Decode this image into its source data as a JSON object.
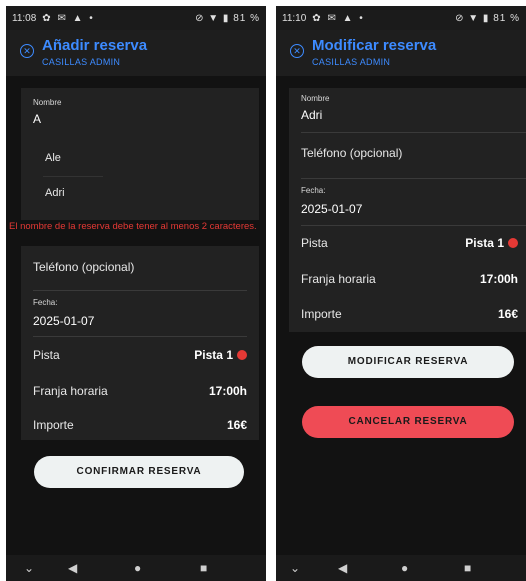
{
  "left": {
    "status": {
      "time": "11:08",
      "icons": "✿ ✉ ▲ •",
      "right": "⊘ ▼ ▮ 81 %"
    },
    "appbar": {
      "title": "Añadir reserva",
      "subtitle": "CASILLAS ADMIN",
      "close_icon": "ⓧ"
    },
    "form": {
      "name_label": "Nombre",
      "name_value": "A",
      "suggestions": [
        "Ale",
        "Adri"
      ],
      "error": "El nombre de la reserva debe tener al menos 2 caracteres.",
      "phone_placeholder": "Teléfono (opcional)",
      "date_label": "Fecha:",
      "date_value": "2025-01-07",
      "court_label": "Pista",
      "court_value": "Pista 1",
      "slot_label": "Franja horaria",
      "slot_value": "17:00h",
      "amount_label": "Importe",
      "amount_value": "16€"
    },
    "confirm_button": "CONFIRMAR RESERVA",
    "nav": {
      "down": "⌄",
      "back": "◀",
      "home": "●",
      "recents": "■"
    }
  },
  "right": {
    "status": {
      "time": "11:10",
      "icons": "✿ ✉ ▲ •",
      "right": "⊘ ▼ ▮ 81 %"
    },
    "appbar": {
      "title": "Modificar reserva",
      "subtitle": "CASILLAS ADMIN",
      "close_icon": "ⓧ"
    },
    "form": {
      "name_label": "Nombre",
      "name_value": "Adri",
      "phone_placeholder": "Teléfono (opcional)",
      "date_label": "Fecha:",
      "date_value": "2025-01-07",
      "court_label": "Pista",
      "court_value": "Pista 1",
      "slot_label": "Franja horaria",
      "slot_value": "17:00h",
      "amount_label": "Importe",
      "amount_value": "16€"
    },
    "modify_button": "MODIFICAR RESERVA",
    "cancel_button": "CANCELAR RESERVA",
    "nav": {
      "down": "⌄",
      "back": "◀",
      "home": "●",
      "recents": "■"
    }
  },
  "colors": {
    "accent": "#3d8bff",
    "error": "#e53935",
    "cancel": "#ef4b55",
    "background": "#121212"
  }
}
